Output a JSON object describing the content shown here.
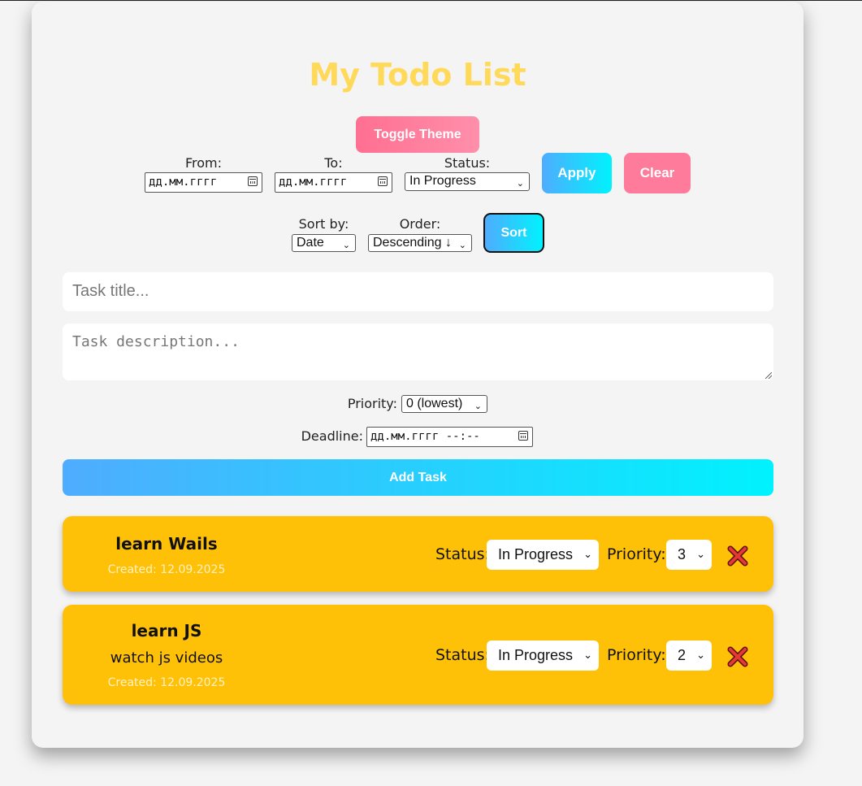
{
  "title": "My Todo List",
  "toggle_theme": "Toggle Theme",
  "filter": {
    "from_label": "From:",
    "from_placeholder": "дд.мм.гггг",
    "to_label": "To:",
    "to_placeholder": "дд.мм.гггг",
    "status_label": "Status:",
    "status_value": "In Progress",
    "apply": "Apply",
    "clear": "Clear"
  },
  "sorting": {
    "sort_by_label": "Sort by:",
    "sort_by_value": "Date",
    "order_label": "Order:",
    "order_value": "Descending ↓",
    "sort_button": "Sort"
  },
  "form": {
    "title_placeholder": "Task title...",
    "description_placeholder": "Task description...",
    "priority_label": "Priority:",
    "priority_value": "0 (lowest)",
    "deadline_label": "Deadline:",
    "deadline_placeholder": "дд.мм.гггг --:--",
    "add_button": "Add Task"
  },
  "tasks": [
    {
      "title": "learn Wails",
      "description": "",
      "created": "Created: 12.09.2025",
      "status_label": "Status:",
      "status": "In Progress",
      "priority_label": "Priority:",
      "priority": "3"
    },
    {
      "title": "learn JS",
      "description": "watch js videos",
      "created": "Created: 12.09.2025",
      "status_label": "Status:",
      "status": "In Progress",
      "priority_label": "Priority:",
      "priority": "2"
    }
  ],
  "colors": {
    "title": "#ffd95a",
    "task_card": "#ffc107",
    "pink_button": "#ff7b9c",
    "blue_gradient_start": "#4facfe",
    "blue_gradient_end": "#00f2fe",
    "delete_icon": "#e53935"
  },
  "icons": {
    "delete": "close-x-icon",
    "date_picker": "calendar-icon",
    "select": "chevron-down-icon"
  }
}
